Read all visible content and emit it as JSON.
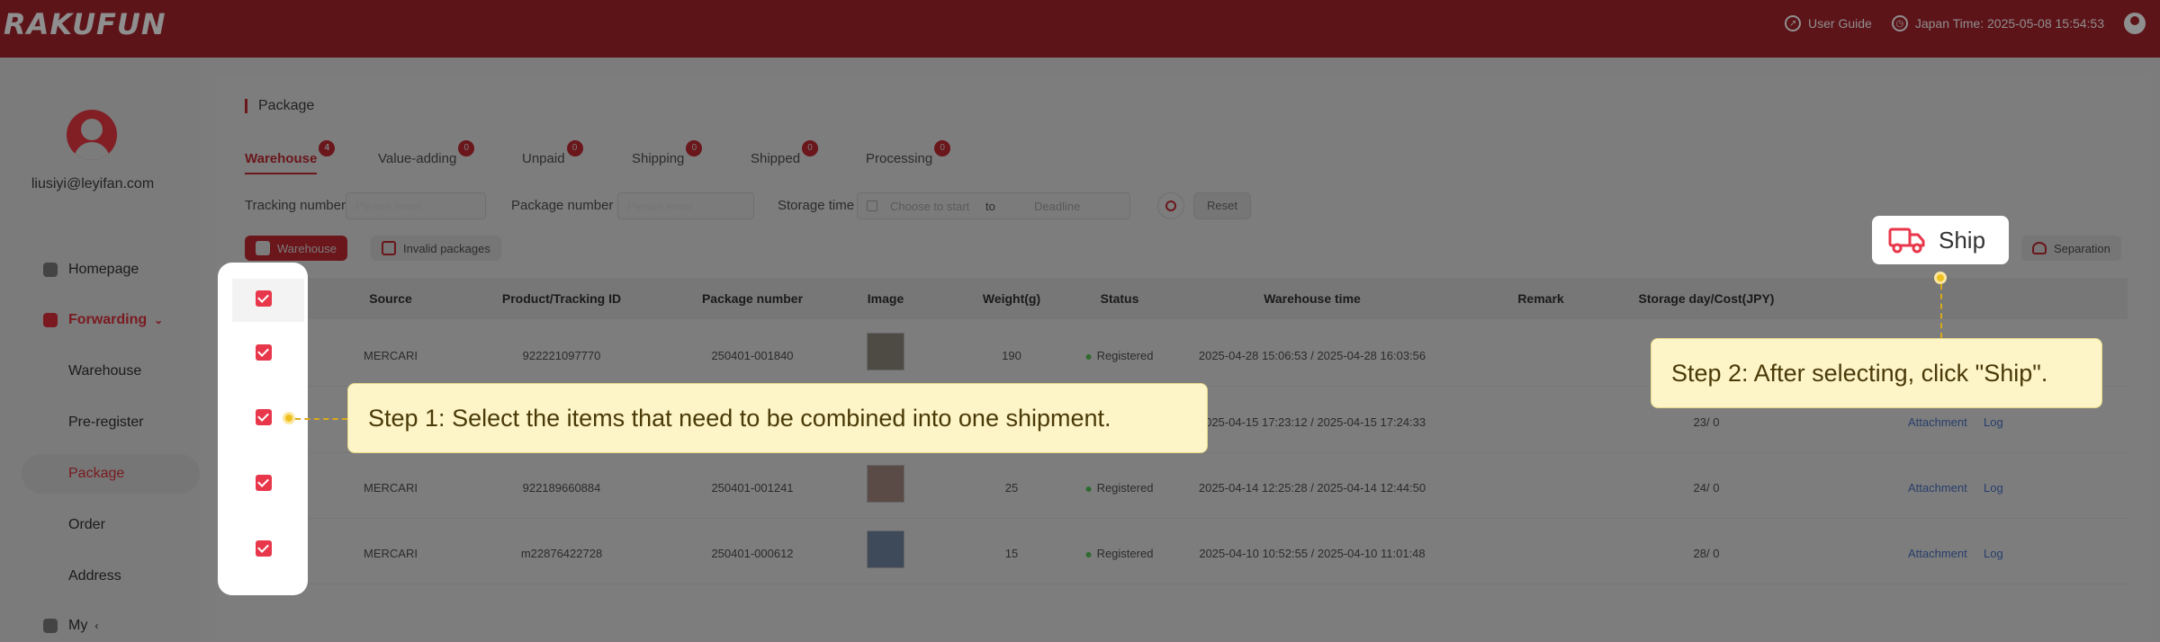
{
  "app": {
    "logo": "RAKUFUN"
  },
  "header": {
    "user_guide": "User Guide",
    "japan_time": "Japan Time: 2025-05-08 15:54:53"
  },
  "sidebar": {
    "email": "liusiyi@leyifan.com",
    "items": [
      {
        "label": "Homepage"
      },
      {
        "label": "Forwarding"
      },
      {
        "label": "Warehouse"
      },
      {
        "label": "Pre-register"
      },
      {
        "label": "Package"
      },
      {
        "label": "Order"
      },
      {
        "label": "Address"
      },
      {
        "label": "My"
      }
    ]
  },
  "page": {
    "title": "Package"
  },
  "tabs": [
    {
      "label": "Warehouse",
      "count": "4"
    },
    {
      "label": "Value-adding",
      "count": "0"
    },
    {
      "label": "Unpaid",
      "count": "0"
    },
    {
      "label": "Shipping",
      "count": "0"
    },
    {
      "label": "Shipped",
      "count": "0"
    },
    {
      "label": "Processing",
      "count": "0"
    }
  ],
  "filters": {
    "tracking_label": "Tracking number",
    "tracking_placeholder": "Please enter",
    "package_label": "Package number",
    "package_placeholder": "Please enter",
    "storage_label": "Storage time",
    "start_placeholder": "Choose to start",
    "to": "to",
    "deadline_placeholder": "Deadline",
    "reset": "Reset"
  },
  "actions": {
    "warehouse": "Warehouse",
    "invalid": "Invalid packages",
    "ship": "Ship",
    "separation": "Separation"
  },
  "table": {
    "headers": [
      "Source",
      "Product/Tracking ID",
      "Package number",
      "Image",
      "Weight(g)",
      "Status",
      "Warehouse time",
      "Remark",
      "Storage day/Cost(JPY)"
    ],
    "rows": [
      {
        "source": "MERCARI",
        "product_id": "922221097770",
        "package_no": "250401-001840",
        "weight": "190",
        "status": "Registered",
        "time": "2025-04-28 15:06:53 / 2025-04-28 16:03:56",
        "storage": ""
      },
      {
        "source": "",
        "product_id": "",
        "package_no": "",
        "weight": "",
        "status": "",
        "time": "2025-04-15 17:23:12 / 2025-04-15 17:24:33",
        "storage": "23/ 0",
        "attachment": "Attachment",
        "log": "Log"
      },
      {
        "source": "MERCARI",
        "product_id": "922189660884",
        "package_no": "250401-001241",
        "weight": "25",
        "status": "Registered",
        "time": "2025-04-14 12:25:28 / 2025-04-14 12:44:50",
        "storage": "24/ 0",
        "attachment": "Attachment",
        "log": "Log"
      },
      {
        "source": "MERCARI",
        "product_id": "m22876422728",
        "package_no": "250401-000612",
        "weight": "15",
        "status": "Registered",
        "time": "2025-04-10 10:52:55 / 2025-04-10 11:01:48",
        "storage": "28/ 0",
        "attachment": "Attachment",
        "log": "Log"
      }
    ]
  },
  "tips": {
    "step1": "Step 1: Select the items that need to be combined into one shipment.",
    "step2": "Step 2: After selecting, click \"Ship\"."
  },
  "colors": {
    "brand": "#b5202c",
    "checkbox": "#e8374b",
    "tip_bg": "#fdf5c8"
  }
}
